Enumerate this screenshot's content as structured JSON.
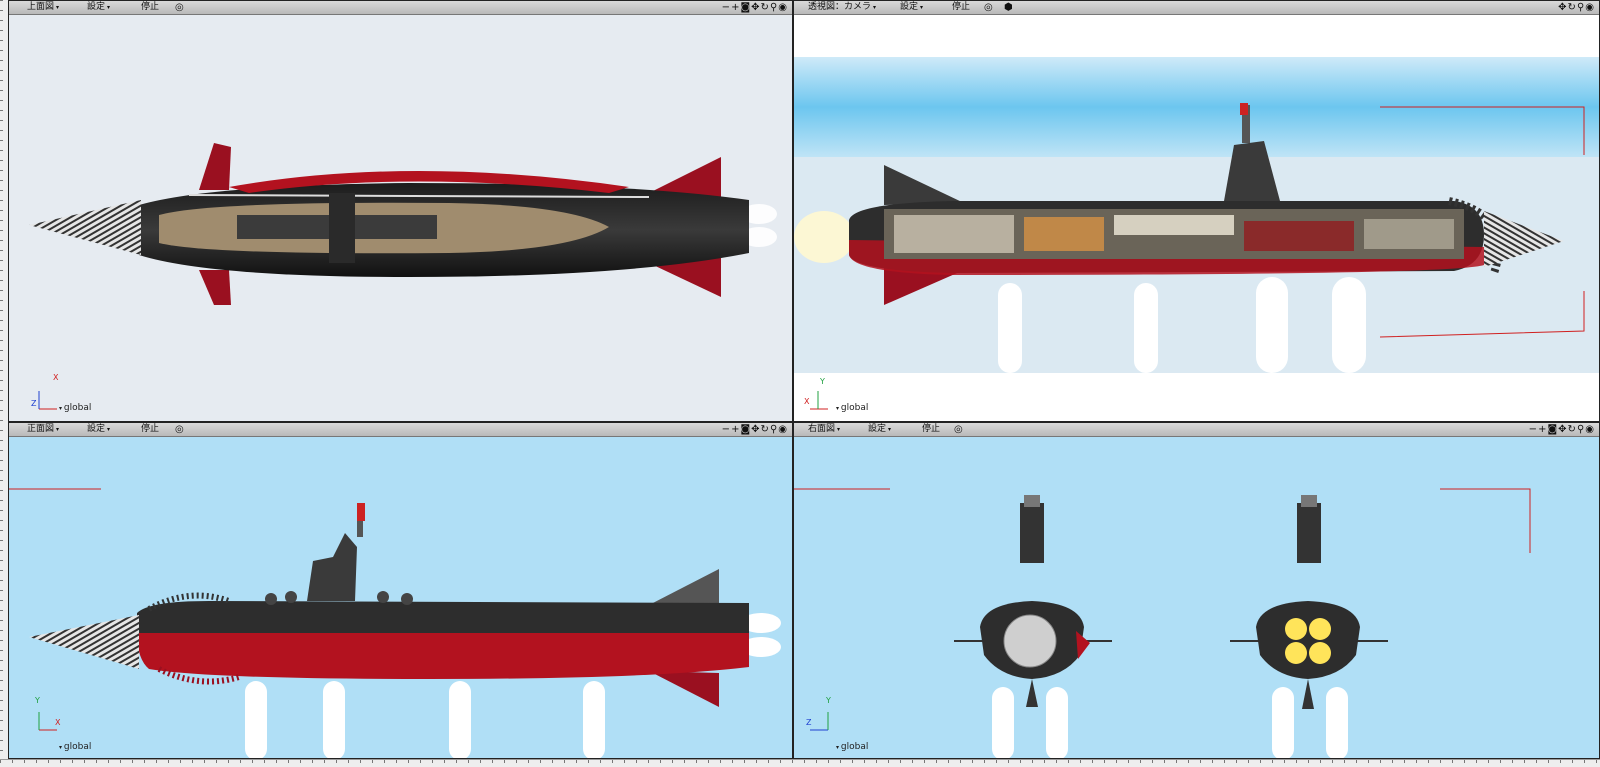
{
  "viewports": {
    "top": {
      "view_label": "上面図",
      "settings_label": "設定",
      "stop_label": "停止",
      "axis": {
        "h": "X",
        "v": "Z",
        "space": "global"
      },
      "background": "#e6ebf1"
    },
    "perspective": {
      "view_label": "透視図：カメラ",
      "settings_label": "設定",
      "stop_label": "停止",
      "axis": {
        "h": "X",
        "v": "Y",
        "space": "global"
      },
      "background": "#ffffff"
    },
    "front": {
      "view_label": "正面図",
      "settings_label": "設定",
      "stop_label": "停止",
      "axis": {
        "h": "X",
        "v": "Y",
        "space": "global"
      },
      "background": "#b0dff6"
    },
    "right": {
      "view_label": "右面図",
      "settings_label": "設定",
      "stop_label": "停止",
      "axis": {
        "h": "Z",
        "v": "Y",
        "space": "global"
      },
      "background": "#b0dff6"
    }
  },
  "icons": {
    "target": "target-icon",
    "zoom_out": "minus-icon",
    "zoom_in": "plus-icon",
    "camera": "camera-icon",
    "pan": "move-icon",
    "rotate": "rotate-icon",
    "magnify": "magnifier-icon",
    "fit": "fit-view-icon",
    "shading": "cube-icon"
  },
  "colors": {
    "hull_dark": "#2e2e2e",
    "hull_red": "#b3121f",
    "fin_red": "#9a1020",
    "deck": "#a08c6e",
    "drill": "#cfcfcf",
    "sky": "#b0dff6",
    "guide_red": "#d02020"
  }
}
